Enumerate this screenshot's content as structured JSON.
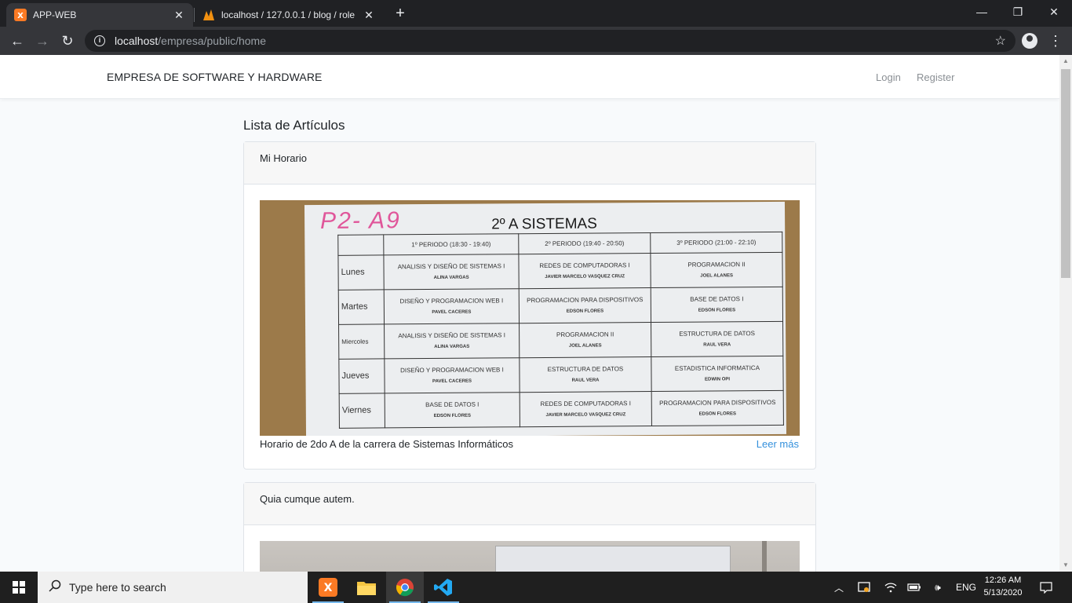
{
  "browser": {
    "tabs": [
      {
        "title": "APP-WEB",
        "active": true
      },
      {
        "title": "localhost / 127.0.0.1 / blog / role",
        "active": false
      }
    ],
    "url_host": "localhost",
    "url_path": "/empresa/public/home"
  },
  "navbar": {
    "brand": "EMPRESA DE SOFTWARE Y HARDWARE",
    "login": "Login",
    "register": "Register"
  },
  "page": {
    "title": "Lista de Artículos"
  },
  "articles": [
    {
      "header": "Mi Horario",
      "caption": "Horario de 2do A de la carrera de Sistemas Informáticos",
      "read_more": "Leer más"
    },
    {
      "header": "Quia cumque autem."
    }
  ],
  "schedule_image": {
    "handwriting": "P2- A9",
    "title": "2º A SISTEMAS",
    "periods": [
      "1º PERIODO (18:30 - 19:40)",
      "2º PERIODO (19:40 - 20:50)",
      "3º PERIODO (21:00 - 22:10)"
    ],
    "rows": [
      {
        "day": "Lunes",
        "cells": [
          {
            "subject": "ANALISIS Y DISEÑO DE SISTEMAS I",
            "teacher": "ALINA VARGAS"
          },
          {
            "subject": "REDES DE COMPUTADORAS I",
            "teacher": "JAVIER MARCELO VASQUEZ CRUZ"
          },
          {
            "subject": "PROGRAMACION II",
            "teacher": "JOEL ALANES"
          }
        ]
      },
      {
        "day": "Martes",
        "cells": [
          {
            "subject": "DISEÑO Y PROGRAMACION WEB I",
            "teacher": "PAVEL CACERES"
          },
          {
            "subject": "PROGRAMACION PARA DISPOSITIVOS",
            "teacher": "EDSON FLORES"
          },
          {
            "subject": "BASE DE DATOS I",
            "teacher": "EDSON FLORES"
          }
        ]
      },
      {
        "day": "Miercoles",
        "cells": [
          {
            "subject": "ANALISIS Y DISEÑO DE SISTEMAS I",
            "teacher": "ALINA VARGAS"
          },
          {
            "subject": "PROGRAMACION II",
            "teacher": "JOEL ALANES"
          },
          {
            "subject": "ESTRUCTURA DE DATOS",
            "teacher": "RAUL VERA"
          }
        ]
      },
      {
        "day": "Jueves",
        "cells": [
          {
            "subject": "DISEÑO Y PROGRAMACION WEB I",
            "teacher": "PAVEL CACERES"
          },
          {
            "subject": "ESTRUCTURA DE DATOS",
            "teacher": "RAUL VERA"
          },
          {
            "subject": "ESTADISTICA INFORMATICA",
            "teacher": "EDWIN OPI"
          }
        ]
      },
      {
        "day": "Viernes",
        "cells": [
          {
            "subject": "BASE DE DATOS I",
            "teacher": "EDSON FLORES"
          },
          {
            "subject": "REDES DE COMPUTADORAS I",
            "teacher": "JAVIER MARCELO VASQUEZ CRUZ"
          },
          {
            "subject": "PROGRAMACION PARA DISPOSITIVOS",
            "teacher": "EDSON FLORES"
          }
        ]
      }
    ]
  },
  "taskbar": {
    "search_placeholder": "Type here to search",
    "language": "ENG",
    "time": "12:26 AM",
    "date": "5/13/2020"
  },
  "colors": {
    "link": "#3490dc",
    "chrome_dark": "#202124",
    "chrome_tab": "#35363a"
  }
}
